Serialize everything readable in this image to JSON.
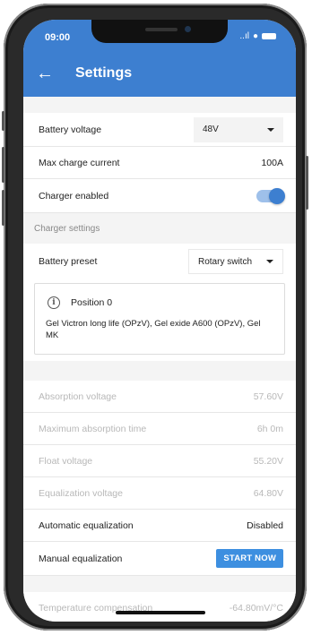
{
  "status": {
    "time": "09:00",
    "signal": "..ıl"
  },
  "header": {
    "back": "←",
    "title": "Settings"
  },
  "battery_voltage": {
    "label": "Battery voltage",
    "value": "48V"
  },
  "max_charge_current": {
    "label": "Max charge current",
    "value": "100A"
  },
  "charger_enabled": {
    "label": "Charger enabled",
    "on": true
  },
  "charger_settings_header": "Charger settings",
  "battery_preset": {
    "label": "Battery preset",
    "value": "Rotary switch"
  },
  "info": {
    "title": "Position 0",
    "body": "Gel Victron long life (OPzV), Gel exide A600 (OPzV), Gel MK"
  },
  "absorption_voltage": {
    "label": "Absorption voltage",
    "value": "57.60V"
  },
  "max_absorption_time": {
    "label": "Maximum absorption time",
    "value": "6h 0m"
  },
  "float_voltage": {
    "label": "Float voltage",
    "value": "55.20V"
  },
  "equalization_voltage": {
    "label": "Equalization voltage",
    "value": "64.80V"
  },
  "automatic_equalization": {
    "label": "Automatic equalization",
    "value": "Disabled"
  },
  "manual_equalization": {
    "label": "Manual equalization",
    "button": "START NOW"
  },
  "temperature_compensation": {
    "label": "Temperature compensation",
    "value": "-64.80mV/°C"
  },
  "colors": {
    "accent": "#3d7fd0",
    "button": "#3d8fe0"
  },
  "icons": {
    "back": "arrow-left-icon",
    "info": "info-circle-icon",
    "dropdown": "caret-down-icon"
  }
}
